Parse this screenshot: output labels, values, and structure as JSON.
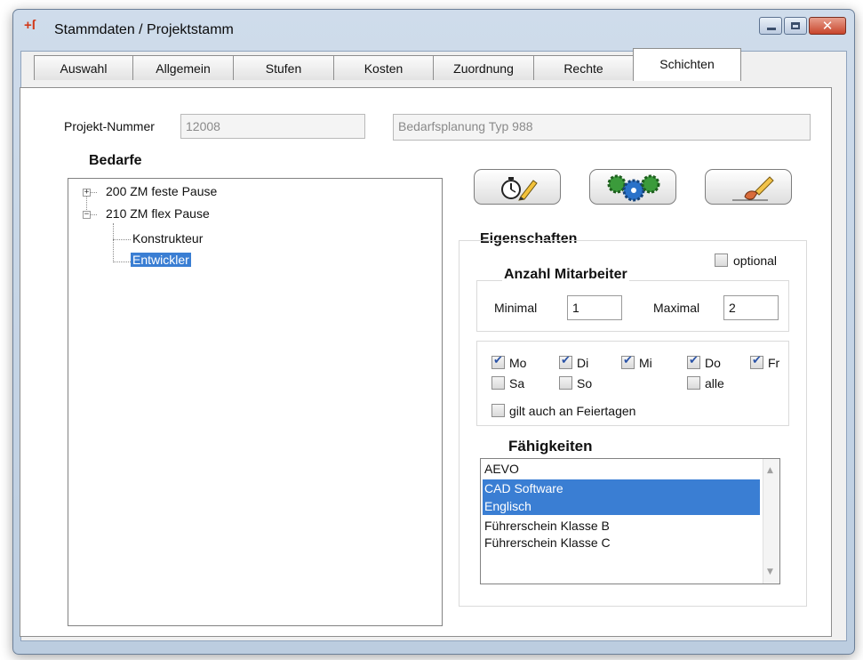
{
  "window": {
    "title": "Stammdaten / Projektstamm",
    "app_icon": "+ſ",
    "close_glyph": "✕"
  },
  "tabs": [
    {
      "label": "Auswahl"
    },
    {
      "label": "Allgemein"
    },
    {
      "label": "Stufen"
    },
    {
      "label": "Kosten"
    },
    {
      "label": "Zuordnung"
    },
    {
      "label": "Rechte"
    },
    {
      "label": "Schichten",
      "active": true
    }
  ],
  "project": {
    "number_label": "Projekt-Nummer",
    "number_value": "12008",
    "name_value": "Bedarfsplanung Typ 988"
  },
  "bedarfe": {
    "heading": "Bedarfe",
    "nodes": [
      {
        "label": "200 ZM feste Pause",
        "expander": "+"
      },
      {
        "label": "210 ZM flex Pause",
        "expander": "−"
      },
      {
        "label": "Konstrukteur"
      },
      {
        "label": "Entwickler",
        "selected": true
      }
    ]
  },
  "toolbar": {
    "icons": [
      "stopwatch-pencil-icon",
      "gears-icon",
      "brush-icon"
    ]
  },
  "eigenschaften": {
    "heading": "Eigenschaften",
    "optional_label": "optional",
    "optional_checked": false
  },
  "mitarbeiter": {
    "heading": "Anzahl Mitarbeiter",
    "min_label": "Minimal",
    "min_value": "1",
    "max_label": "Maximal",
    "max_value": "2"
  },
  "days": {
    "mo": {
      "label": "Mo",
      "checked": true
    },
    "di": {
      "label": "Di",
      "checked": true
    },
    "mi": {
      "label": "Mi",
      "checked": true
    },
    "do": {
      "label": "Do",
      "checked": true
    },
    "fr": {
      "label": "Fr",
      "checked": true
    },
    "sa": {
      "label": "Sa",
      "checked": false
    },
    "so": {
      "label": "So",
      "checked": false
    },
    "alle": {
      "label": "alle",
      "checked": false
    },
    "feiertage": {
      "label": "gilt auch an Feiertagen",
      "checked": false
    }
  },
  "faehigkeiten": {
    "heading": "Fähigkeiten",
    "items": [
      {
        "label": "AEVO",
        "selected": false
      },
      {
        "label": "CAD Software",
        "selected": true
      },
      {
        "label": "Englisch",
        "selected": true
      },
      {
        "label": "Führerschein Klasse B",
        "selected": false
      },
      {
        "label": "Führerschein Klasse C",
        "selected": false
      }
    ]
  },
  "colors": {
    "selection": "#3a7ed3",
    "check": "#2b53a6",
    "close_button": "#c8452c"
  }
}
